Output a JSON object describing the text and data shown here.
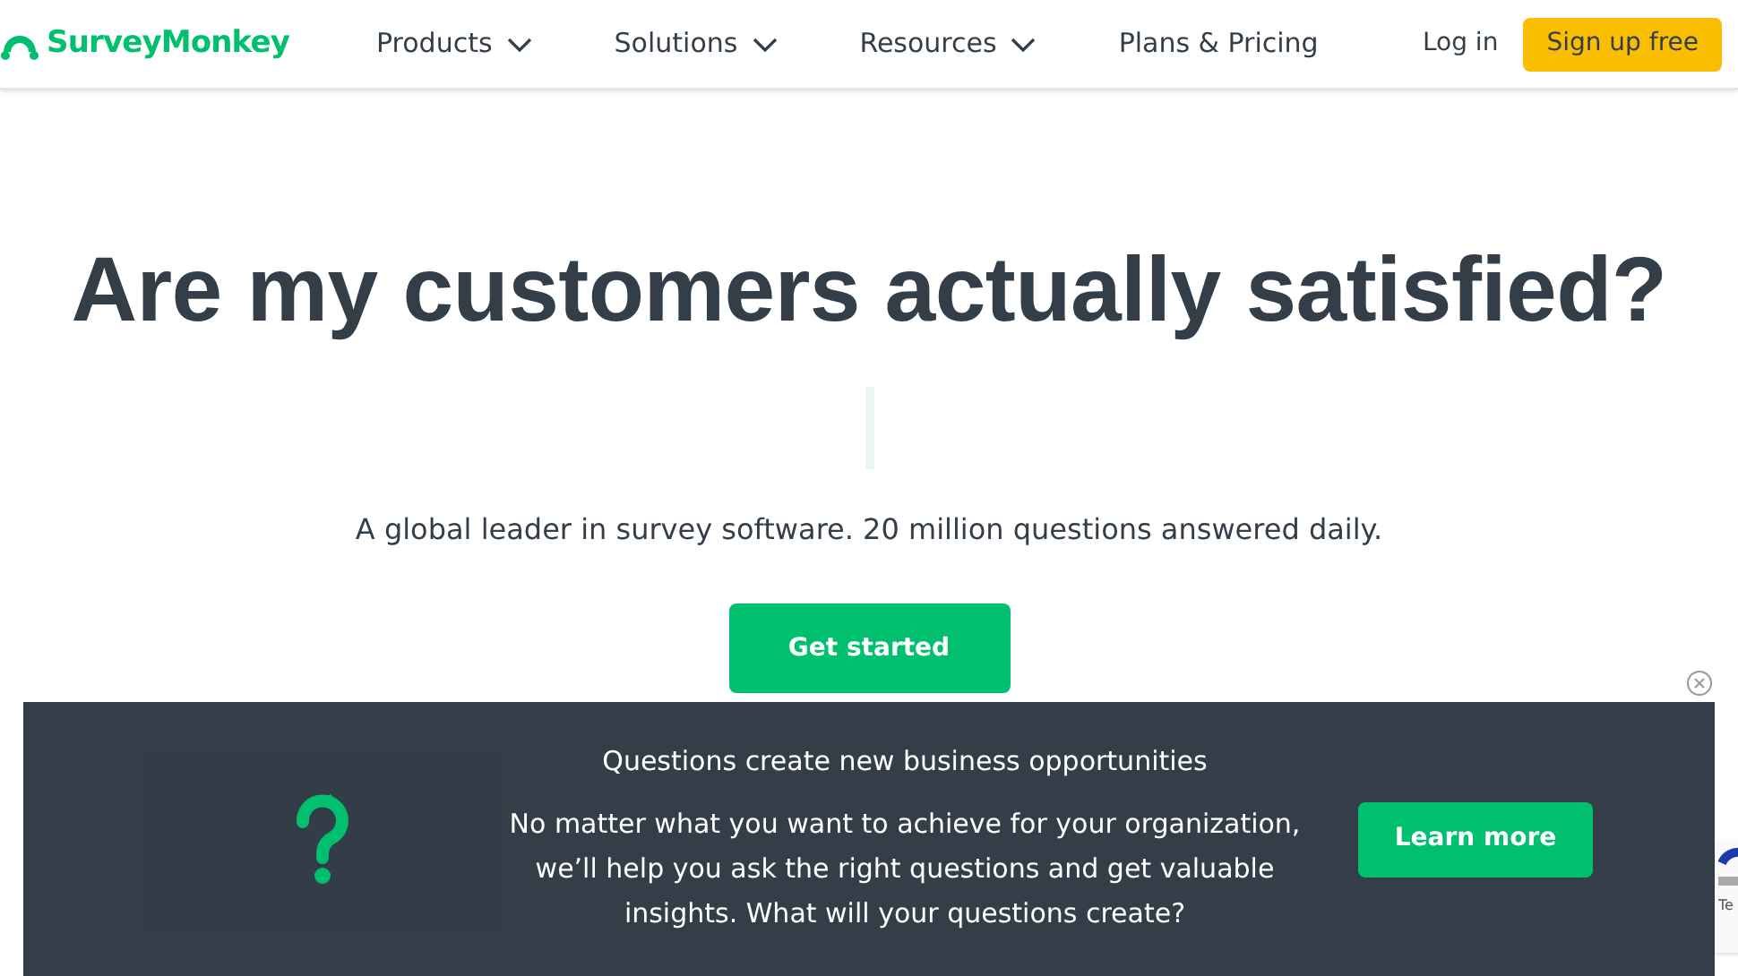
{
  "header": {
    "logo": "SurveyMonkey",
    "nav": [
      {
        "label": "Products",
        "dropdown": true
      },
      {
        "label": "Solutions",
        "dropdown": true
      },
      {
        "label": "Resources",
        "dropdown": true
      },
      {
        "label": "Plans & Pricing",
        "dropdown": false
      }
    ],
    "login": "Log in",
    "signup": "Sign up free"
  },
  "hero": {
    "title": "Are my customers actually satisfied?",
    "subtitle": "A global leader in survey software. 20 million questions answered daily.",
    "cta": "Get started"
  },
  "banner": {
    "title": "Questions create new business opportunities",
    "body": "No matter what you want to achieve for your organization, we’ll help you ask the right questions and get valuable insights. What will your questions create?",
    "button": "Learn more"
  },
  "recaptcha": {
    "text": "Te"
  }
}
